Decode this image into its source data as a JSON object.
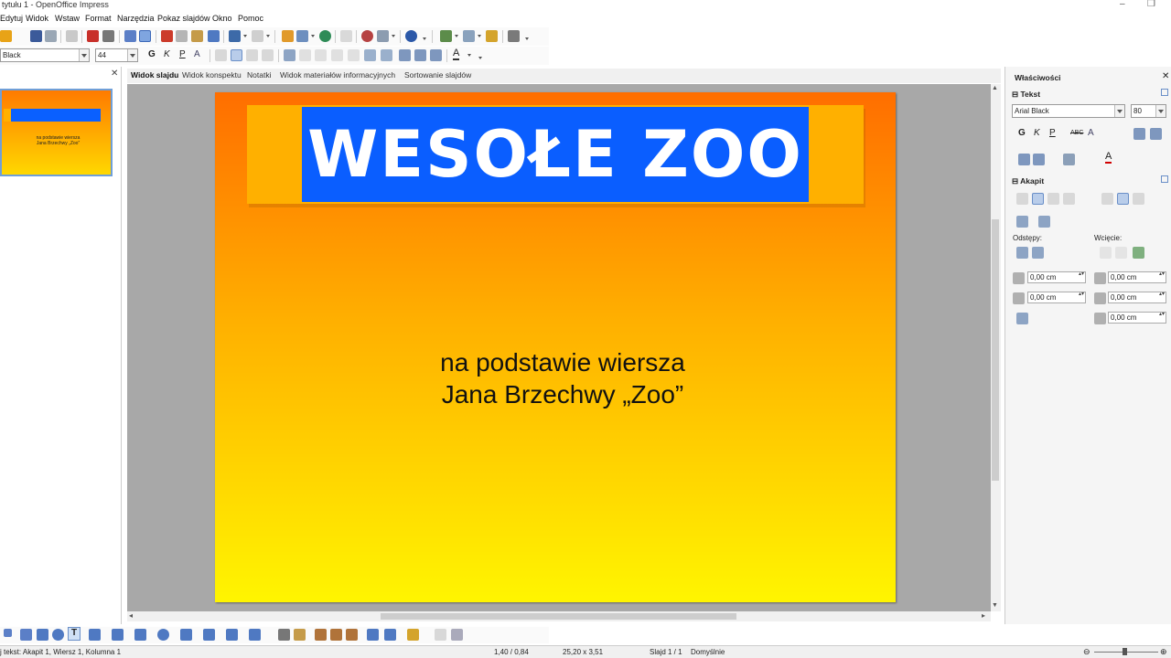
{
  "window": {
    "title": "tytułu 1 - OpenOffice Impress"
  },
  "menu": [
    "Edytuj",
    "Widok",
    "Wstaw",
    "Format",
    "Narzędzia",
    "Pokaz slajdów",
    "Okno",
    "Pomoc"
  ],
  "format_bar": {
    "font_name": "Black",
    "font_size": "44"
  },
  "slides_pane": {
    "thumb_text_line1": "na podstawie wiersza",
    "thumb_text_line2": "Jana Brzechwy „Zoo”"
  },
  "view_tabs": [
    "Widok slajdu",
    "Widok konspektu",
    "Notatki",
    "Widok materiałów informacyjnych",
    "Sortowanie slajdów"
  ],
  "slide": {
    "title": "WESOŁE ZOO",
    "subtitle_line1": "na podstawie wiersza",
    "subtitle_line2": "Jana Brzechwy „Zoo”"
  },
  "properties": {
    "header": "Właściwości",
    "text_section": "Tekst",
    "font_name": "Arial Black",
    "font_size": "80",
    "paragraph_section": "Akapit",
    "spacing_label": "Odstępy:",
    "indent_label": "Wcięcie:",
    "above": "0,00 cm",
    "below": "0,00 cm",
    "before": "0,00 cm",
    "after": "0,00 cm",
    "first_line": "0,00 cm"
  },
  "status": {
    "text": "j tekst: Akapit 1, Wiersz 1, Kolumna 1",
    "position": "1,40 / 0,84",
    "size": "25,20 x 3,51",
    "slide": "Slajd 1 / 1",
    "layout": "Domyślnie"
  },
  "colors": {
    "title_bg": "#0a5eff",
    "title_frame": "#ffb000",
    "gradient_top": "#ff6e00",
    "gradient_bottom": "#fff500",
    "font_color_icon": "#d00000"
  }
}
